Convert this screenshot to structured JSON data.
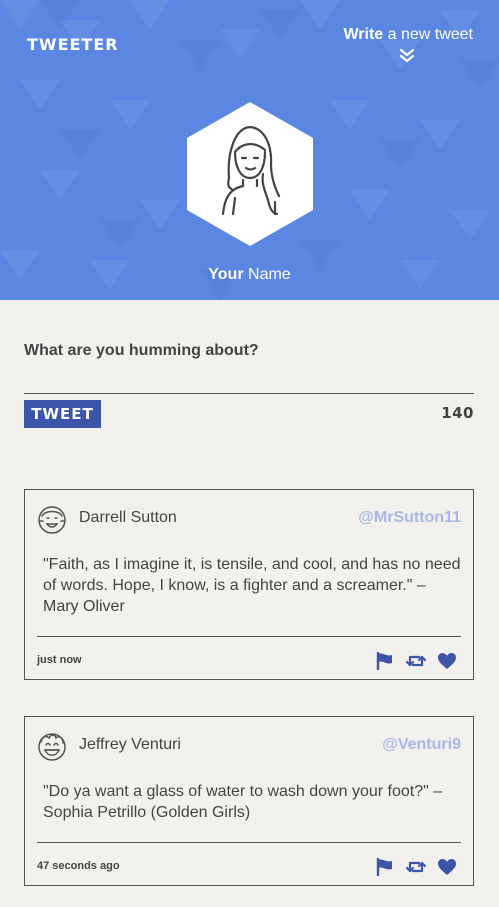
{
  "header": {
    "logo": "TWEETER",
    "write_strong": "Write",
    "write_rest": " a new tweet",
    "user_strong": "Your",
    "user_rest": " Name",
    "accent_color": "#5b87e3"
  },
  "compose": {
    "prompt": "What are you humming about?",
    "button_label": "TWEET",
    "char_count": "140",
    "button_color": "#3c55a8"
  },
  "tweets": [
    {
      "name": "Darrell Sutton",
      "handle": "@MrSutton11",
      "text": "\"Faith, as I imagine it, is tensile, and cool, and has no need of words. Hope, I know, is a fighter and a screamer.\" – Mary Oliver",
      "time": "just now",
      "avatar_icon": "smiling-face-avatar-icon"
    },
    {
      "name": "Jeffrey Venturi",
      "handle": "@Venturi9",
      "text": "\"Do ya want a glass of water to wash down your foot?\" – Sophia Petrillo (Golden Girls)",
      "time": "47 seconds ago",
      "avatar_icon": "laughing-face-avatar-icon"
    }
  ],
  "icons": {
    "flag": "flag-icon",
    "retweet": "retweet-icon",
    "like": "heart-icon",
    "action_color": "#3c55a8"
  }
}
